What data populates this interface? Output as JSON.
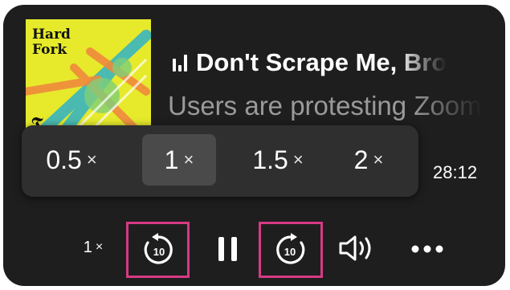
{
  "episode": {
    "art_title": "Hard\nFork",
    "art_logo": "𝕿",
    "title": "Don't Scrape Me, Bro",
    "subtitle": "Users are protesting Zoom's terms"
  },
  "speed_menu": {
    "options": [
      {
        "num": "0.5",
        "x": "×"
      },
      {
        "num": "1",
        "x": "×"
      },
      {
        "num": "1.5",
        "x": "×"
      },
      {
        "num": "2",
        "x": "×"
      }
    ],
    "selected_index": 1
  },
  "time": {
    "remaining": "28:12"
  },
  "controls": {
    "rate_num": "1",
    "rate_x": "×",
    "skip_back_seconds": "10",
    "skip_forward_seconds": "10"
  },
  "colors": {
    "background": "#1e1e1e",
    "highlight": "#d63a84",
    "art_yellow": "#e6ea2b"
  },
  "icons": [
    "bars-icon",
    "skip-back-10-icon",
    "pause-icon",
    "skip-forward-10-icon",
    "volume-icon",
    "more-icon"
  ]
}
